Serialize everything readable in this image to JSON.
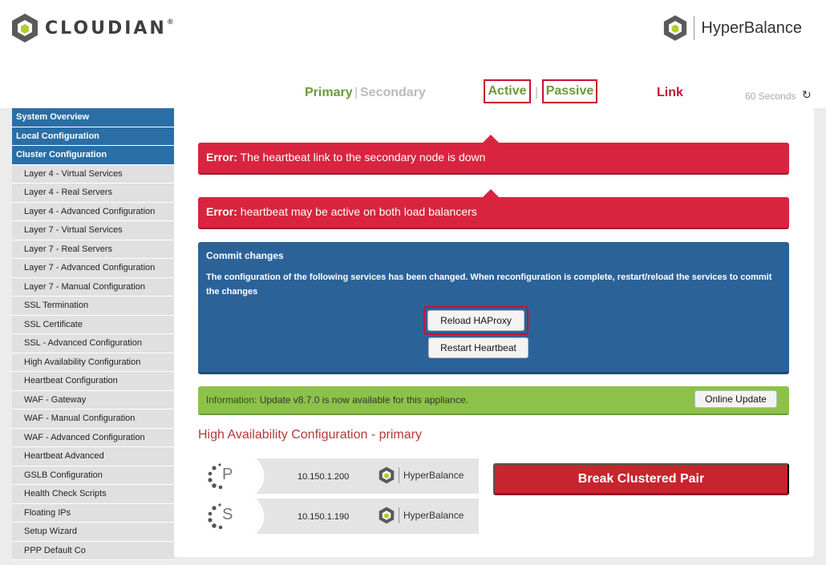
{
  "brand": {
    "name": "CLOUDIAN",
    "reg": "®",
    "product": "HyperBalance"
  },
  "status": {
    "primary": "Primary",
    "secondary": "Secondary",
    "active": "Active",
    "passive": "Passive",
    "link": "Link",
    "timer": "60 Seconds",
    "refresh_icon": "refresh-icon"
  },
  "sidebar": {
    "items": [
      {
        "label": "System Overview",
        "level": "main"
      },
      {
        "label": "Local Configuration",
        "level": "main"
      },
      {
        "label": "Cluster Configuration",
        "level": "main"
      },
      {
        "label": "Layer 4 - Virtual Services",
        "level": "sub"
      },
      {
        "label": "Layer 4 - Real Servers",
        "level": "sub"
      },
      {
        "label": "Layer 4 - Advanced Configuration",
        "level": "sub"
      },
      {
        "label": "Layer 7 - Virtual Services",
        "level": "sub"
      },
      {
        "label": "Layer 7 - Real Servers",
        "level": "sub"
      },
      {
        "label": "Layer 7 - Advanced Configuration",
        "level": "sub"
      },
      {
        "label": "Layer 7 - Manual Configuration",
        "level": "sub"
      },
      {
        "label": "SSL Termination",
        "level": "sub"
      },
      {
        "label": "SSL Certificate",
        "level": "sub"
      },
      {
        "label": "SSL - Advanced Configuration",
        "level": "sub"
      },
      {
        "label": "High Availability Configuration",
        "level": "sub"
      },
      {
        "label": "Heartbeat Configuration",
        "level": "sub"
      },
      {
        "label": "WAF - Gateway",
        "level": "sub"
      },
      {
        "label": "WAF - Manual Configuration",
        "level": "sub"
      },
      {
        "label": "WAF - Advanced Configuration",
        "level": "sub"
      },
      {
        "label": "Heartbeat Advanced",
        "level": "sub"
      },
      {
        "label": "GSLB Configuration",
        "level": "sub"
      },
      {
        "label": "Health Check Scripts",
        "level": "sub"
      },
      {
        "label": "Floating IPs",
        "level": "sub"
      },
      {
        "label": "Setup Wizard",
        "level": "sub"
      },
      {
        "label": "PPP Default Co",
        "level": "sub"
      }
    ]
  },
  "errors": [
    {
      "prefix": "Error:",
      "message": "The heartbeat link to the secondary node is down"
    },
    {
      "prefix": "Error:",
      "message": "heartbeat may be active on both load balancers"
    }
  ],
  "commit": {
    "title": "Commit changes",
    "description": "The configuration of the following services has been changed. When reconfiguration is complete, restart/reload the services to commit the changes",
    "reload_label": "Reload HAProxy",
    "restart_label": "Restart Heartbeat"
  },
  "info": {
    "prefix": "Information:",
    "message": "Update v8.7.0 is now available for this appliance.",
    "button": "Online Update"
  },
  "ha": {
    "title": "High Availability Configuration - primary",
    "nodes": [
      {
        "letter": "P",
        "ip": "10.150.1.200",
        "product": "HyperBalance"
      },
      {
        "letter": "S",
        "ip": "10.150.1.190",
        "product": "HyperBalance"
      }
    ],
    "break_label": "Break Clustered Pair"
  },
  "colors": {
    "nav_blue": "#2b6ea5",
    "error_red": "#d9243f",
    "commit_blue": "#2b6399",
    "info_green": "#8cc24a",
    "break_red": "#c8242e"
  }
}
